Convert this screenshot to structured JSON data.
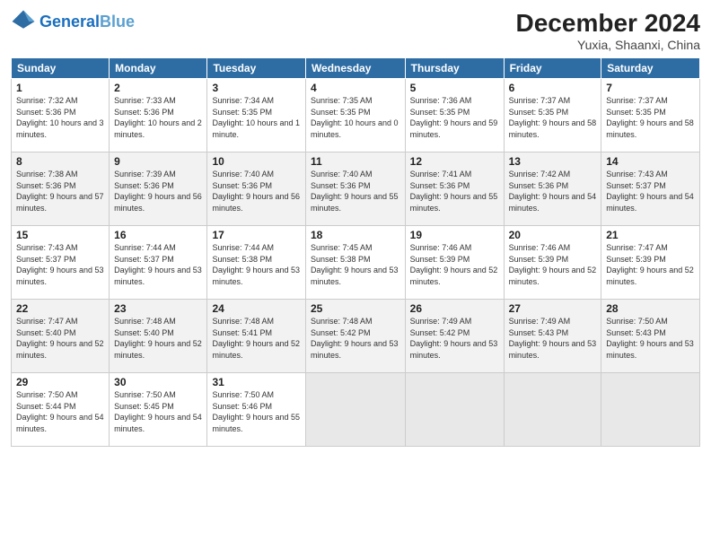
{
  "header": {
    "logo_general": "General",
    "logo_blue": "Blue",
    "month_title": "December 2024",
    "location": "Yuxia, Shaanxi, China"
  },
  "columns": [
    "Sunday",
    "Monday",
    "Tuesday",
    "Wednesday",
    "Thursday",
    "Friday",
    "Saturday"
  ],
  "weeks": [
    [
      {
        "day": "1",
        "sunrise": "Sunrise: 7:32 AM",
        "sunset": "Sunset: 5:36 PM",
        "daylight": "Daylight: 10 hours and 3 minutes."
      },
      {
        "day": "2",
        "sunrise": "Sunrise: 7:33 AM",
        "sunset": "Sunset: 5:36 PM",
        "daylight": "Daylight: 10 hours and 2 minutes."
      },
      {
        "day": "3",
        "sunrise": "Sunrise: 7:34 AM",
        "sunset": "Sunset: 5:35 PM",
        "daylight": "Daylight: 10 hours and 1 minute."
      },
      {
        "day": "4",
        "sunrise": "Sunrise: 7:35 AM",
        "sunset": "Sunset: 5:35 PM",
        "daylight": "Daylight: 10 hours and 0 minutes."
      },
      {
        "day": "5",
        "sunrise": "Sunrise: 7:36 AM",
        "sunset": "Sunset: 5:35 PM",
        "daylight": "Daylight: 9 hours and 59 minutes."
      },
      {
        "day": "6",
        "sunrise": "Sunrise: 7:37 AM",
        "sunset": "Sunset: 5:35 PM",
        "daylight": "Daylight: 9 hours and 58 minutes."
      },
      {
        "day": "7",
        "sunrise": "Sunrise: 7:37 AM",
        "sunset": "Sunset: 5:35 PM",
        "daylight": "Daylight: 9 hours and 58 minutes."
      }
    ],
    [
      {
        "day": "8",
        "sunrise": "Sunrise: 7:38 AM",
        "sunset": "Sunset: 5:36 PM",
        "daylight": "Daylight: 9 hours and 57 minutes."
      },
      {
        "day": "9",
        "sunrise": "Sunrise: 7:39 AM",
        "sunset": "Sunset: 5:36 PM",
        "daylight": "Daylight: 9 hours and 56 minutes."
      },
      {
        "day": "10",
        "sunrise": "Sunrise: 7:40 AM",
        "sunset": "Sunset: 5:36 PM",
        "daylight": "Daylight: 9 hours and 56 minutes."
      },
      {
        "day": "11",
        "sunrise": "Sunrise: 7:40 AM",
        "sunset": "Sunset: 5:36 PM",
        "daylight": "Daylight: 9 hours and 55 minutes."
      },
      {
        "day": "12",
        "sunrise": "Sunrise: 7:41 AM",
        "sunset": "Sunset: 5:36 PM",
        "daylight": "Daylight: 9 hours and 55 minutes."
      },
      {
        "day": "13",
        "sunrise": "Sunrise: 7:42 AM",
        "sunset": "Sunset: 5:36 PM",
        "daylight": "Daylight: 9 hours and 54 minutes."
      },
      {
        "day": "14",
        "sunrise": "Sunrise: 7:43 AM",
        "sunset": "Sunset: 5:37 PM",
        "daylight": "Daylight: 9 hours and 54 minutes."
      }
    ],
    [
      {
        "day": "15",
        "sunrise": "Sunrise: 7:43 AM",
        "sunset": "Sunset: 5:37 PM",
        "daylight": "Daylight: 9 hours and 53 minutes."
      },
      {
        "day": "16",
        "sunrise": "Sunrise: 7:44 AM",
        "sunset": "Sunset: 5:37 PM",
        "daylight": "Daylight: 9 hours and 53 minutes."
      },
      {
        "day": "17",
        "sunrise": "Sunrise: 7:44 AM",
        "sunset": "Sunset: 5:38 PM",
        "daylight": "Daylight: 9 hours and 53 minutes."
      },
      {
        "day": "18",
        "sunrise": "Sunrise: 7:45 AM",
        "sunset": "Sunset: 5:38 PM",
        "daylight": "Daylight: 9 hours and 53 minutes."
      },
      {
        "day": "19",
        "sunrise": "Sunrise: 7:46 AM",
        "sunset": "Sunset: 5:39 PM",
        "daylight": "Daylight: 9 hours and 52 minutes."
      },
      {
        "day": "20",
        "sunrise": "Sunrise: 7:46 AM",
        "sunset": "Sunset: 5:39 PM",
        "daylight": "Daylight: 9 hours and 52 minutes."
      },
      {
        "day": "21",
        "sunrise": "Sunrise: 7:47 AM",
        "sunset": "Sunset: 5:39 PM",
        "daylight": "Daylight: 9 hours and 52 minutes."
      }
    ],
    [
      {
        "day": "22",
        "sunrise": "Sunrise: 7:47 AM",
        "sunset": "Sunset: 5:40 PM",
        "daylight": "Daylight: 9 hours and 52 minutes."
      },
      {
        "day": "23",
        "sunrise": "Sunrise: 7:48 AM",
        "sunset": "Sunset: 5:40 PM",
        "daylight": "Daylight: 9 hours and 52 minutes."
      },
      {
        "day": "24",
        "sunrise": "Sunrise: 7:48 AM",
        "sunset": "Sunset: 5:41 PM",
        "daylight": "Daylight: 9 hours and 52 minutes."
      },
      {
        "day": "25",
        "sunrise": "Sunrise: 7:48 AM",
        "sunset": "Sunset: 5:42 PM",
        "daylight": "Daylight: 9 hours and 53 minutes."
      },
      {
        "day": "26",
        "sunrise": "Sunrise: 7:49 AM",
        "sunset": "Sunset: 5:42 PM",
        "daylight": "Daylight: 9 hours and 53 minutes."
      },
      {
        "day": "27",
        "sunrise": "Sunrise: 7:49 AM",
        "sunset": "Sunset: 5:43 PM",
        "daylight": "Daylight: 9 hours and 53 minutes."
      },
      {
        "day": "28",
        "sunrise": "Sunrise: 7:50 AM",
        "sunset": "Sunset: 5:43 PM",
        "daylight": "Daylight: 9 hours and 53 minutes."
      }
    ],
    [
      {
        "day": "29",
        "sunrise": "Sunrise: 7:50 AM",
        "sunset": "Sunset: 5:44 PM",
        "daylight": "Daylight: 9 hours and 54 minutes."
      },
      {
        "day": "30",
        "sunrise": "Sunrise: 7:50 AM",
        "sunset": "Sunset: 5:45 PM",
        "daylight": "Daylight: 9 hours and 54 minutes."
      },
      {
        "day": "31",
        "sunrise": "Sunrise: 7:50 AM",
        "sunset": "Sunset: 5:46 PM",
        "daylight": "Daylight: 9 hours and 55 minutes."
      },
      null,
      null,
      null,
      null
    ]
  ]
}
